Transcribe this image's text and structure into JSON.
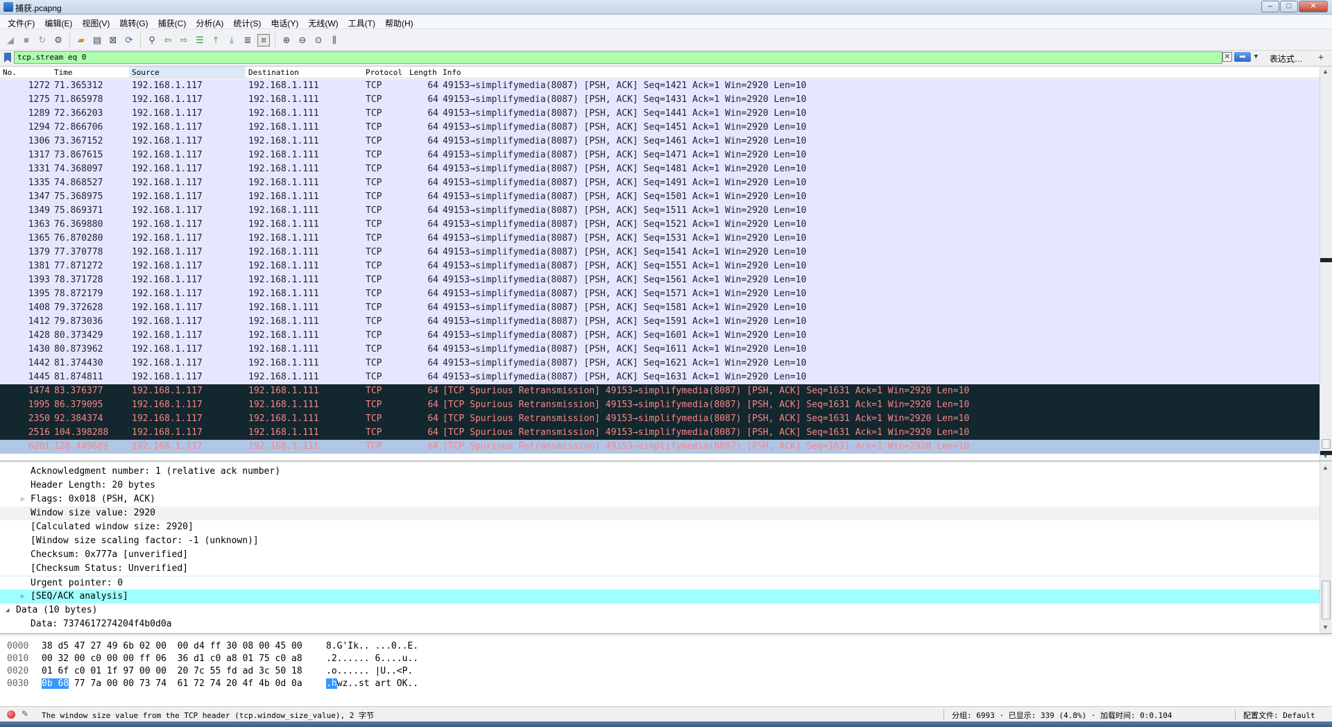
{
  "window": {
    "title": "捕获.pcapng"
  },
  "menu": [
    "文件(F)",
    "编辑(E)",
    "视图(V)",
    "跳转(G)",
    "捕获(C)",
    "分析(A)",
    "统计(S)",
    "电话(Y)",
    "无线(W)",
    "工具(T)",
    "帮助(H)"
  ],
  "filter": {
    "value": "tcp.stream eq 0",
    "expression_label": "表达式…",
    "plus_label": "+"
  },
  "columns": {
    "no": "No.",
    "time": "Time",
    "source": "Source",
    "destination": "Destination",
    "protocol": "Protocol",
    "length": "Length",
    "info": "Info"
  },
  "packets": [
    {
      "no": "1272",
      "time": "71.365312",
      "src": "192.168.1.117",
      "dst": "192.168.1.111",
      "proto": "TCP",
      "len": "64",
      "info": "49153→simplifymedia(8087) [PSH, ACK] Seq=1421 Ack=1 Win=2920 Len=10",
      "style": "normal"
    },
    {
      "no": "1275",
      "time": "71.865978",
      "src": "192.168.1.117",
      "dst": "192.168.1.111",
      "proto": "TCP",
      "len": "64",
      "info": "49153→simplifymedia(8087) [PSH, ACK] Seq=1431 Ack=1 Win=2920 Len=10",
      "style": "normal"
    },
    {
      "no": "1289",
      "time": "72.366203",
      "src": "192.168.1.117",
      "dst": "192.168.1.111",
      "proto": "TCP",
      "len": "64",
      "info": "49153→simplifymedia(8087) [PSH, ACK] Seq=1441 Ack=1 Win=2920 Len=10",
      "style": "normal"
    },
    {
      "no": "1294",
      "time": "72.866706",
      "src": "192.168.1.117",
      "dst": "192.168.1.111",
      "proto": "TCP",
      "len": "64",
      "info": "49153→simplifymedia(8087) [PSH, ACK] Seq=1451 Ack=1 Win=2920 Len=10",
      "style": "normal"
    },
    {
      "no": "1306",
      "time": "73.367152",
      "src": "192.168.1.117",
      "dst": "192.168.1.111",
      "proto": "TCP",
      "len": "64",
      "info": "49153→simplifymedia(8087) [PSH, ACK] Seq=1461 Ack=1 Win=2920 Len=10",
      "style": "normal"
    },
    {
      "no": "1317",
      "time": "73.867615",
      "src": "192.168.1.117",
      "dst": "192.168.1.111",
      "proto": "TCP",
      "len": "64",
      "info": "49153→simplifymedia(8087) [PSH, ACK] Seq=1471 Ack=1 Win=2920 Len=10",
      "style": "normal"
    },
    {
      "no": "1331",
      "time": "74.368097",
      "src": "192.168.1.117",
      "dst": "192.168.1.111",
      "proto": "TCP",
      "len": "64",
      "info": "49153→simplifymedia(8087) [PSH, ACK] Seq=1481 Ack=1 Win=2920 Len=10",
      "style": "normal"
    },
    {
      "no": "1335",
      "time": "74.868527",
      "src": "192.168.1.117",
      "dst": "192.168.1.111",
      "proto": "TCP",
      "len": "64",
      "info": "49153→simplifymedia(8087) [PSH, ACK] Seq=1491 Ack=1 Win=2920 Len=10",
      "style": "normal"
    },
    {
      "no": "1347",
      "time": "75.368975",
      "src": "192.168.1.117",
      "dst": "192.168.1.111",
      "proto": "TCP",
      "len": "64",
      "info": "49153→simplifymedia(8087) [PSH, ACK] Seq=1501 Ack=1 Win=2920 Len=10",
      "style": "normal"
    },
    {
      "no": "1349",
      "time": "75.869371",
      "src": "192.168.1.117",
      "dst": "192.168.1.111",
      "proto": "TCP",
      "len": "64",
      "info": "49153→simplifymedia(8087) [PSH, ACK] Seq=1511 Ack=1 Win=2920 Len=10",
      "style": "normal"
    },
    {
      "no": "1363",
      "time": "76.369880",
      "src": "192.168.1.117",
      "dst": "192.168.1.111",
      "proto": "TCP",
      "len": "64",
      "info": "49153→simplifymedia(8087) [PSH, ACK] Seq=1521 Ack=1 Win=2920 Len=10",
      "style": "normal"
    },
    {
      "no": "1365",
      "time": "76.870280",
      "src": "192.168.1.117",
      "dst": "192.168.1.111",
      "proto": "TCP",
      "len": "64",
      "info": "49153→simplifymedia(8087) [PSH, ACK] Seq=1531 Ack=1 Win=2920 Len=10",
      "style": "normal"
    },
    {
      "no": "1379",
      "time": "77.370778",
      "src": "192.168.1.117",
      "dst": "192.168.1.111",
      "proto": "TCP",
      "len": "64",
      "info": "49153→simplifymedia(8087) [PSH, ACK] Seq=1541 Ack=1 Win=2920 Len=10",
      "style": "normal"
    },
    {
      "no": "1381",
      "time": "77.871272",
      "src": "192.168.1.117",
      "dst": "192.168.1.111",
      "proto": "TCP",
      "len": "64",
      "info": "49153→simplifymedia(8087) [PSH, ACK] Seq=1551 Ack=1 Win=2920 Len=10",
      "style": "normal"
    },
    {
      "no": "1393",
      "time": "78.371728",
      "src": "192.168.1.117",
      "dst": "192.168.1.111",
      "proto": "TCP",
      "len": "64",
      "info": "49153→simplifymedia(8087) [PSH, ACK] Seq=1561 Ack=1 Win=2920 Len=10",
      "style": "normal"
    },
    {
      "no": "1395",
      "time": "78.872179",
      "src": "192.168.1.117",
      "dst": "192.168.1.111",
      "proto": "TCP",
      "len": "64",
      "info": "49153→simplifymedia(8087) [PSH, ACK] Seq=1571 Ack=1 Win=2920 Len=10",
      "style": "normal"
    },
    {
      "no": "1408",
      "time": "79.372628",
      "src": "192.168.1.117",
      "dst": "192.168.1.111",
      "proto": "TCP",
      "len": "64",
      "info": "49153→simplifymedia(8087) [PSH, ACK] Seq=1581 Ack=1 Win=2920 Len=10",
      "style": "normal"
    },
    {
      "no": "1412",
      "time": "79.873036",
      "src": "192.168.1.117",
      "dst": "192.168.1.111",
      "proto": "TCP",
      "len": "64",
      "info": "49153→simplifymedia(8087) [PSH, ACK] Seq=1591 Ack=1 Win=2920 Len=10",
      "style": "normal"
    },
    {
      "no": "1428",
      "time": "80.373429",
      "src": "192.168.1.117",
      "dst": "192.168.1.111",
      "proto": "TCP",
      "len": "64",
      "info": "49153→simplifymedia(8087) [PSH, ACK] Seq=1601 Ack=1 Win=2920 Len=10",
      "style": "normal"
    },
    {
      "no": "1430",
      "time": "80.873962",
      "src": "192.168.1.117",
      "dst": "192.168.1.111",
      "proto": "TCP",
      "len": "64",
      "info": "49153→simplifymedia(8087) [PSH, ACK] Seq=1611 Ack=1 Win=2920 Len=10",
      "style": "normal"
    },
    {
      "no": "1442",
      "time": "81.374430",
      "src": "192.168.1.117",
      "dst": "192.168.1.111",
      "proto": "TCP",
      "len": "64",
      "info": "49153→simplifymedia(8087) [PSH, ACK] Seq=1621 Ack=1 Win=2920 Len=10",
      "style": "normal"
    },
    {
      "no": "1445",
      "time": "81.874811",
      "src": "192.168.1.117",
      "dst": "192.168.1.111",
      "proto": "TCP",
      "len": "64",
      "info": "49153→simplifymedia(8087) [PSH, ACK] Seq=1631 Ack=1 Win=2920 Len=10",
      "style": "normal"
    },
    {
      "no": "1474",
      "time": "83.376377",
      "src": "192.168.1.117",
      "dst": "192.168.1.111",
      "proto": "TCP",
      "len": "64",
      "info": "[TCP Spurious Retransmission] 49153→simplifymedia(8087) [PSH, ACK] Seq=1631 Ack=1 Win=2920 Len=10",
      "style": "dark"
    },
    {
      "no": "1995",
      "time": "86.379095",
      "src": "192.168.1.117",
      "dst": "192.168.1.111",
      "proto": "TCP",
      "len": "64",
      "info": "[TCP Spurious Retransmission] 49153→simplifymedia(8087) [PSH, ACK] Seq=1631 Ack=1 Win=2920 Len=10",
      "style": "dark"
    },
    {
      "no": "2350",
      "time": "92.384374",
      "src": "192.168.1.117",
      "dst": "192.168.1.111",
      "proto": "TCP",
      "len": "64",
      "info": "[TCP Spurious Retransmission] 49153→simplifymedia(8087) [PSH, ACK] Seq=1631 Ack=1 Win=2920 Len=10",
      "style": "dark"
    },
    {
      "no": "2516",
      "time": "104.398288",
      "src": "192.168.1.117",
      "dst": "192.168.1.111",
      "proto": "TCP",
      "len": "64",
      "info": "[TCP Spurious Retransmission] 49153→simplifymedia(8087) [PSH, ACK] Seq=1631 Ack=1 Win=2920 Len=10",
      "style": "dark"
    },
    {
      "no": "6281",
      "time": "128.449689",
      "src": "192.168.1.117",
      "dst": "192.168.1.111",
      "proto": "TCP",
      "len": "64",
      "info": "[TCP Spurious Retransmission] 49153→simplifymedia(8087) [PSH, ACK] Seq=1631 Ack=1 Win=2920 Len=10",
      "style": "selected"
    }
  ],
  "details": [
    {
      "indent": 1,
      "expander": "",
      "text": "Acknowledgment number: 1    (relative ack number)",
      "style": ""
    },
    {
      "indent": 1,
      "expander": "",
      "text": "Header Length: 20 bytes",
      "style": ""
    },
    {
      "indent": 1,
      "expander": "▷",
      "text": "Flags: 0x018 (PSH, ACK)",
      "style": ""
    },
    {
      "indent": 1,
      "expander": "",
      "text": "Window size value: 2920",
      "style": "hl"
    },
    {
      "indent": 1,
      "expander": "",
      "text": "[Calculated window size: 2920]",
      "style": ""
    },
    {
      "indent": 1,
      "expander": "",
      "text": "[Window size scaling factor: -1 (unknown)]",
      "style": ""
    },
    {
      "indent": 1,
      "expander": "",
      "text": "Checksum: 0x777a [unverified]",
      "style": ""
    },
    {
      "indent": 1,
      "expander": "",
      "text": "[Checksum Status: Unverified]",
      "style": ""
    },
    {
      "indent": 1,
      "expander": "",
      "text": "Urgent pointer: 0",
      "style": "border"
    },
    {
      "indent": 1,
      "expander": "▷",
      "text": "[SEQ/ACK analysis]",
      "style": "active"
    },
    {
      "indent": 0,
      "expander": "◢",
      "text": "Data (10 bytes)",
      "style": ""
    },
    {
      "indent": 1,
      "expander": "",
      "text": "Data: 7374617274204f4b0d0a",
      "style": ""
    }
  ],
  "bytes": [
    {
      "offset": "0000",
      "hex_pre": "",
      "hex_sel": "",
      "hex_post": "38 d5 47 27 49 6b 02 00  00 d4 ff 30 08 00 45 00",
      "asc_pre": "",
      "asc_sel": "",
      "asc_post": "8.G'Ik.. ...0..E."
    },
    {
      "offset": "0010",
      "hex_pre": "",
      "hex_sel": "",
      "hex_post": "00 32 00 c0 00 00 ff 06  36 d1 c0 a8 01 75 c0 a8",
      "asc_pre": "",
      "asc_sel": "",
      "asc_post": ".2...... 6....u.."
    },
    {
      "offset": "0020",
      "hex_pre": "",
      "hex_sel": "",
      "hex_post": "01 6f c0 01 1f 97 00 00  20 7c 55 fd ad 3c 50 18",
      "asc_pre": "",
      "asc_sel": "",
      "asc_post": ".o...... |U..<P."
    },
    {
      "offset": "0030",
      "hex_pre": "",
      "hex_sel": "0b 68",
      "hex_post": " 77 7a 00 00 73 74  61 72 74 20 4f 4b 0d 0a",
      "asc_pre": "",
      "asc_sel": ".h",
      "asc_post": "wz..st art OK.."
    }
  ],
  "status": {
    "field_info": "The window size value from the TCP header (tcp.window_size_value), 2 字节",
    "stats": "分组: 6993 · 已显示: 339 (4.8%) · 加载时间: 0:0.104",
    "profile": "配置文件: Default"
  }
}
